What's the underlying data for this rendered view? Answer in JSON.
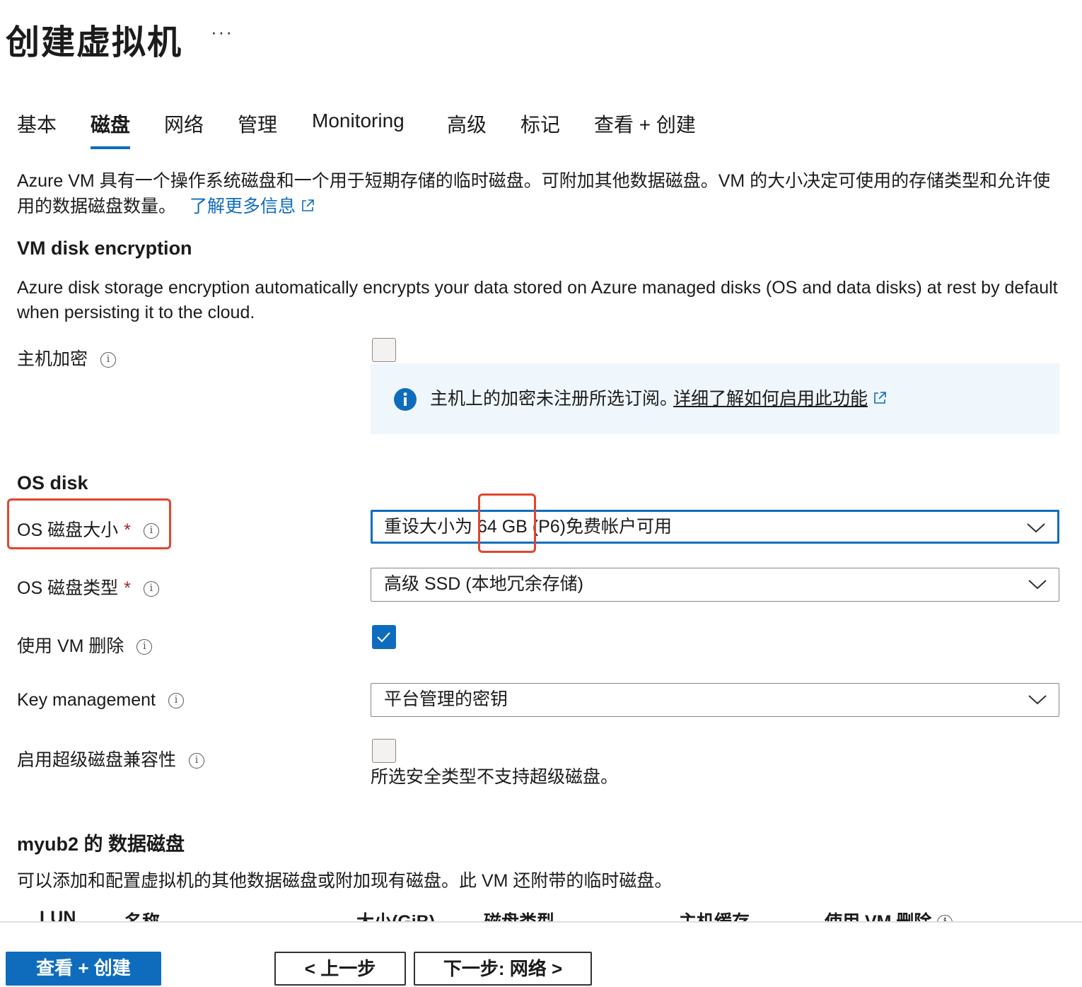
{
  "page": {
    "title": "创建虚拟机",
    "more_label": "···"
  },
  "tabs": [
    {
      "label": "基本"
    },
    {
      "label": "磁盘"
    },
    {
      "label": "网络"
    },
    {
      "label": "管理"
    },
    {
      "label": "Monitoring"
    },
    {
      "label": "高级"
    },
    {
      "label": "标记"
    },
    {
      "label": "查看 + 创建"
    }
  ],
  "active_tab": "磁盘",
  "intro": {
    "text": "Azure VM 具有一个操作系统磁盘和一个用于短期存储的临时磁盘。可附加其他数据磁盘。VM 的大小决定可使用的存储类型和允许使用的数据磁盘数量。",
    "link": "了解更多信息"
  },
  "encryption": {
    "heading": "VM disk encryption",
    "description": "Azure disk storage encryption automatically encrypts your data stored on Azure managed disks (OS and data disks) at rest by default when persisting it to the cloud.",
    "host_label": "主机加密",
    "host_checked": false,
    "info_message": "主机上的加密未注册所选订阅。",
    "info_link": "详细了解如何启用此功能"
  },
  "os_disk": {
    "heading": "OS disk",
    "size_label": "OS 磁盘大小",
    "size_value": "重设大小为 64 GB (P6)免费帐户可用",
    "type_label": "OS 磁盘类型",
    "type_value": "高级 SSD (本地冗余存储)",
    "delete_label": "使用 VM 删除",
    "delete_checked": true,
    "key_label": "Key management",
    "key_value": "平台管理的密钥",
    "ultra_label": "启用超级磁盘兼容性",
    "ultra_checked": false,
    "ultra_note": "所选安全类型不支持超级磁盘。",
    "required_mark": "*"
  },
  "data_disks": {
    "heading": "myub2 的 数据磁盘",
    "description": "可以添加和配置虚拟机的其他数据磁盘或附加现有磁盘。此 VM 还附带的临时磁盘。",
    "columns": [
      "LUN",
      "名称",
      "大小(GiB)",
      "磁盘类型",
      "主机缓存",
      "使用 VM 删除"
    ]
  },
  "footer": {
    "review_button": "查看 + 创建",
    "prev_button": "< 上一步",
    "next_button": "下一步: 网络 >"
  },
  "colors": {
    "accent": "#0f6cbd",
    "highlight": "#e0452d",
    "info_bg": "#eff6fc"
  }
}
